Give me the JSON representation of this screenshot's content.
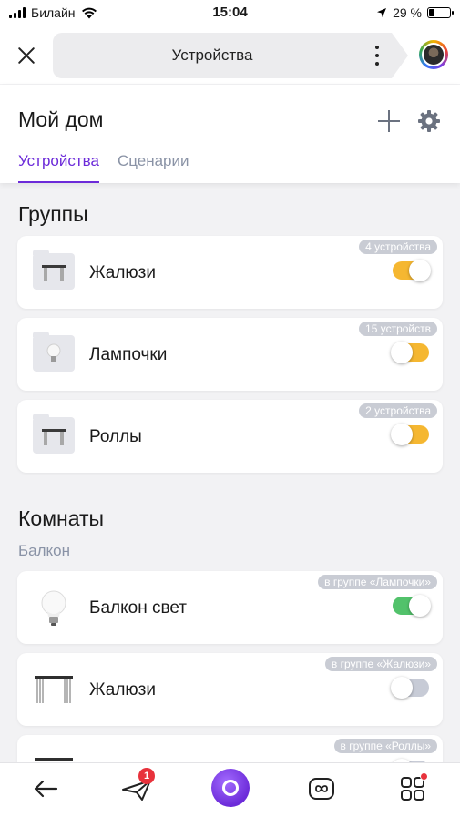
{
  "status_bar": {
    "carrier": "Билайн",
    "time": "15:04",
    "battery": "29 %",
    "battery_level": 0.29
  },
  "topbar": {
    "title": "Устройства"
  },
  "home": {
    "title": "Мой дом",
    "tabs": [
      {
        "label": "Устройства",
        "active": true
      },
      {
        "label": "Сценарии",
        "active": false
      }
    ]
  },
  "groups_section": {
    "title": "Группы",
    "items": [
      {
        "name": "Жалюзи",
        "badge": "4 устройства",
        "icon": "blinds-folder-icon",
        "toggle": "on",
        "toggle_color": "#f5b731"
      },
      {
        "name": "Лампочки",
        "badge": "15 устройств",
        "icon": "bulb-folder-icon",
        "toggle": "off",
        "toggle_color": "#f5b731"
      },
      {
        "name": "Роллы",
        "badge": "2 устройства",
        "icon": "rolls-folder-icon",
        "toggle": "off",
        "toggle_color": "#f5b731"
      }
    ]
  },
  "rooms_section": {
    "title": "Комнаты",
    "room": "Балкон",
    "items": [
      {
        "name": "Балкон свет",
        "badge": "в группе «Лампочки»",
        "icon": "bulb-icon",
        "toggle": "on",
        "toggle_color": "#52c26b"
      },
      {
        "name": "Жалюзи",
        "badge": "в группе «Жалюзи»",
        "icon": "blinds-icon",
        "toggle": "off",
        "toggle_color": "#c7cbd6"
      },
      {
        "name": "",
        "badge": "в группе «Роллы»",
        "icon": "rolls-icon",
        "toggle": "off",
        "toggle_color": "#c7cbd6"
      }
    ]
  },
  "bottom_nav": {
    "notification_count": "1"
  },
  "colors": {
    "accent": "#6c2bd9",
    "muted": "#8a93a6"
  }
}
